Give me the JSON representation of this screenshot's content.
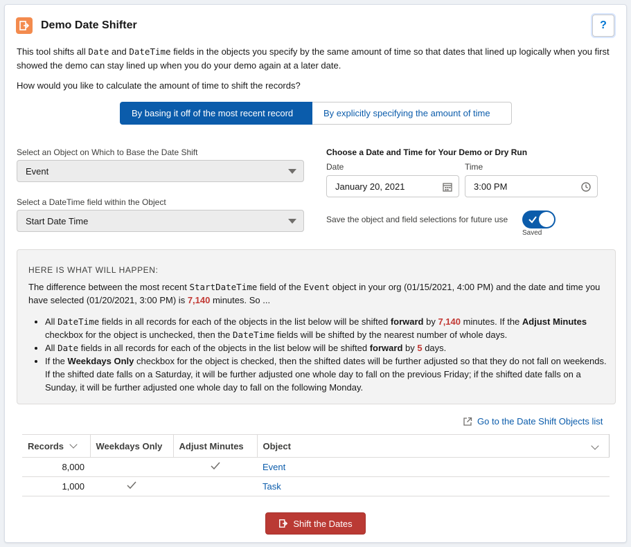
{
  "header": {
    "title": "Demo Date Shifter",
    "help_label": "?",
    "app_icon": "exit-icon",
    "app_icon_color": "#f38b4e"
  },
  "intro": {
    "p1": "This tool shifts all ",
    "code1": "Date",
    "p2": " and ",
    "code2": "DateTime",
    "p3": " fields in the objects you specify by the same amount of time so that dates that lined up logically when you first showed the demo can stay lined up when you do your demo again at a later date."
  },
  "question": "How would you like to calculate the amount of time to shift the records?",
  "mode_toggle": {
    "options": [
      "By basing it off of the most recent record",
      "By explicitly specifying the amount of time"
    ],
    "selected": "By basing it off of the most recent record"
  },
  "object_select": {
    "label": "Select an Object on Which to Base the Date Shift",
    "value": "Event"
  },
  "field_select": {
    "label": "Select a DateTime field within the Object",
    "value": "Start Date Time"
  },
  "schedule": {
    "heading": "Choose a Date and Time for Your Demo or Dry Run",
    "date_label": "Date",
    "date_value": "January 20, 2021",
    "time_label": "Time",
    "time_value": "3:00 PM"
  },
  "save_toggle": {
    "label": "Save the object and field selections for future use",
    "state_label": "Saved",
    "checked": true
  },
  "summary": {
    "heading": "HERE IS WHAT WILL HAPPEN:",
    "t1": "The difference between the most recent ",
    "c1": "StartDateTime",
    "t2": " field of the ",
    "c2": "Event",
    "t3": " object in your org (01/15/2021, 4:00 PM) and the date and time you have selected (01/20/2021, 3:00 PM) is ",
    "minutes": "7,140",
    "t4": " minutes. So ...",
    "b1_a": "All ",
    "b1_code": "DateTime",
    "b1_b": " fields in all records for each of the objects in the list below will be shifted ",
    "b1_forward": "forward",
    "b1_c": " by ",
    "b1_minutes": "7,140",
    "b1_d": " minutes. If the ",
    "b1_adjust": "Adjust Minutes",
    "b1_e": " checkbox for the object is unchecked, then the ",
    "b1_code2": "DateTime",
    "b1_f": " fields will be shifted by the nearest number of whole days.",
    "b2_a": "All ",
    "b2_code": "Date",
    "b2_b": " fields in all records for each of the objects in the list below will be shifted ",
    "b2_forward": "forward",
    "b2_c": " by ",
    "b2_days": "5",
    "b2_d": " days.",
    "b3_a": "If the ",
    "b3_weekdays": "Weekdays Only",
    "b3_b": " checkbox for the object is checked, then the shifted dates will be further adjusted so that they do not fall on weekends. If the shifted date falls on a Saturday, it will be further adjusted one whole day to fall on the previous Friday; if the shifted date falls on a Sunday, it will be further adjusted one whole day to fall on the following Monday."
  },
  "goto_link": "Go to the Date Shift Objects list",
  "table": {
    "columns": [
      "Records",
      "Weekdays Only",
      "Adjust Minutes",
      "Object"
    ],
    "rows": [
      {
        "records": "8,000",
        "weekdays_only": false,
        "adjust_minutes": true,
        "object": "Event"
      },
      {
        "records": "1,000",
        "weekdays_only": true,
        "adjust_minutes": false,
        "object": "Task"
      }
    ]
  },
  "action_button": {
    "label": "Shift the Dates",
    "color": "#ba3a34"
  },
  "colors": {
    "brand": "#0b5cab",
    "highlight": "#c23934"
  }
}
